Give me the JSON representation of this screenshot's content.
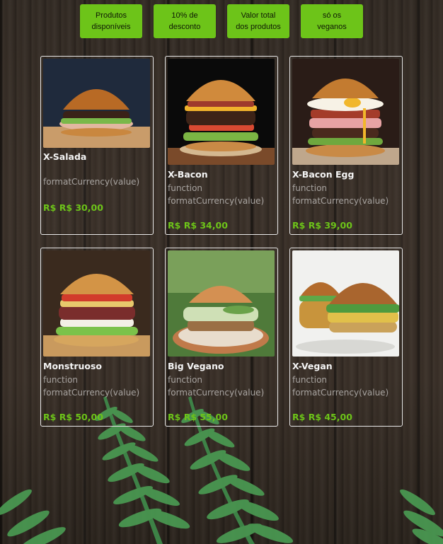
{
  "buttons": [
    {
      "label_line1": "Produtos",
      "label_line2": "disponíveis"
    },
    {
      "label_line1": "10% de",
      "label_line2": "desconto"
    },
    {
      "label_line1": "Valor total",
      "label_line2": "dos produtos"
    },
    {
      "label_line1": "só os",
      "label_line2": "veganos"
    }
  ],
  "products": [
    {
      "name": "X-Salada",
      "desc_line1": "",
      "desc_line2": "formatCurrency(value)",
      "price_prefix": "R$",
      "price": "R$ 30,00"
    },
    {
      "name": "X-Bacon",
      "desc_line1": "function",
      "desc_line2": "formatCurrency(value)",
      "price_prefix": "R$",
      "price": "R$ 34,00"
    },
    {
      "name": "X-Bacon Egg",
      "desc_line1": "function",
      "desc_line2": "formatCurrency(value)",
      "price_prefix": "R$",
      "price": "R$ 39,00"
    },
    {
      "name": "Monstruoso",
      "desc_line1": "function",
      "desc_line2": "formatCurrency(value)",
      "price_prefix": "R$",
      "price": "R$ 50,00"
    },
    {
      "name": "Big Vegano",
      "desc_line1": "function",
      "desc_line2": "formatCurrency(value)",
      "price_prefix": "R$",
      "price": "R$ 55,00"
    },
    {
      "name": "X-Vegan",
      "desc_line1": "function",
      "desc_line2": "formatCurrency(value)",
      "price_prefix": "R$",
      "price": "R$ 45,00"
    }
  ],
  "colors": {
    "accent": "#6dc419",
    "card_border": "#e8e8e8",
    "text": "#f4f4f4"
  }
}
